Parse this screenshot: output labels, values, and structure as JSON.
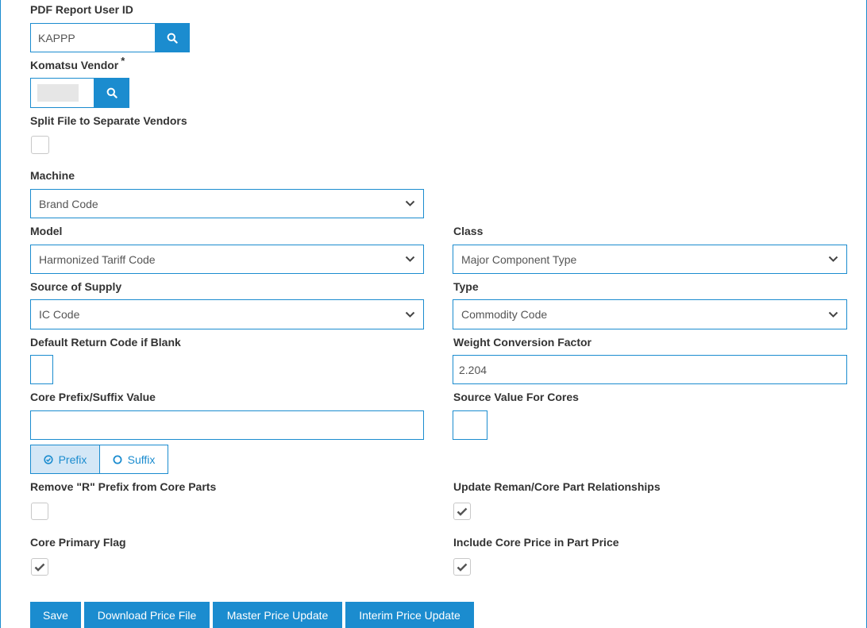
{
  "fields": {
    "pdf_report_user_id": {
      "label": "PDF Report User ID",
      "value": "KAPPP"
    },
    "komatsu_vendor": {
      "label": "Komatsu Vendor",
      "required_mark": "*",
      "value": ""
    },
    "split_file": {
      "label": "Split File to Separate Vendors",
      "checked": false
    },
    "machine": {
      "label": "Machine",
      "selected": "Brand Code"
    },
    "model": {
      "label": "Model",
      "selected": "Harmonized Tariff Code"
    },
    "class": {
      "label": "Class",
      "selected": "Major Component Type"
    },
    "source_of_supply": {
      "label": "Source of Supply",
      "selected": "IC Code"
    },
    "type": {
      "label": "Type",
      "selected": "Commodity Code"
    },
    "default_return_code": {
      "label": "Default Return Code if Blank",
      "value": ""
    },
    "weight_conversion_factor": {
      "label": "Weight Conversion Factor",
      "value": "2.204"
    },
    "core_prefix_suffix_value": {
      "label": "Core Prefix/Suffix Value",
      "value": ""
    },
    "source_value_for_cores": {
      "label": "Source Value For Cores",
      "value": ""
    },
    "prefix_suffix": {
      "prefix_label": "Prefix",
      "suffix_label": "Suffix",
      "selected": "Prefix"
    },
    "remove_r_prefix": {
      "label": "Remove \"R\" Prefix from Core Parts",
      "checked": false
    },
    "update_reman_core": {
      "label": "Update Reman/Core Part Relationships",
      "checked": true
    },
    "core_primary_flag": {
      "label": "Core Primary Flag",
      "checked": true
    },
    "include_core_price": {
      "label": "Include Core Price in Part Price",
      "checked": true
    }
  },
  "buttons": {
    "save": "Save",
    "download_price_file": "Download Price File",
    "master_price_update": "Master Price Update",
    "interim_price_update": "Interim Price Update"
  },
  "colors": {
    "accent": "#1b8ccf",
    "toggle_active_bg": "#d4e7f6",
    "text": "#333333"
  },
  "icons": {
    "search": "search-icon",
    "select": "chevron-down-icon",
    "check": "checkmark-icon"
  }
}
